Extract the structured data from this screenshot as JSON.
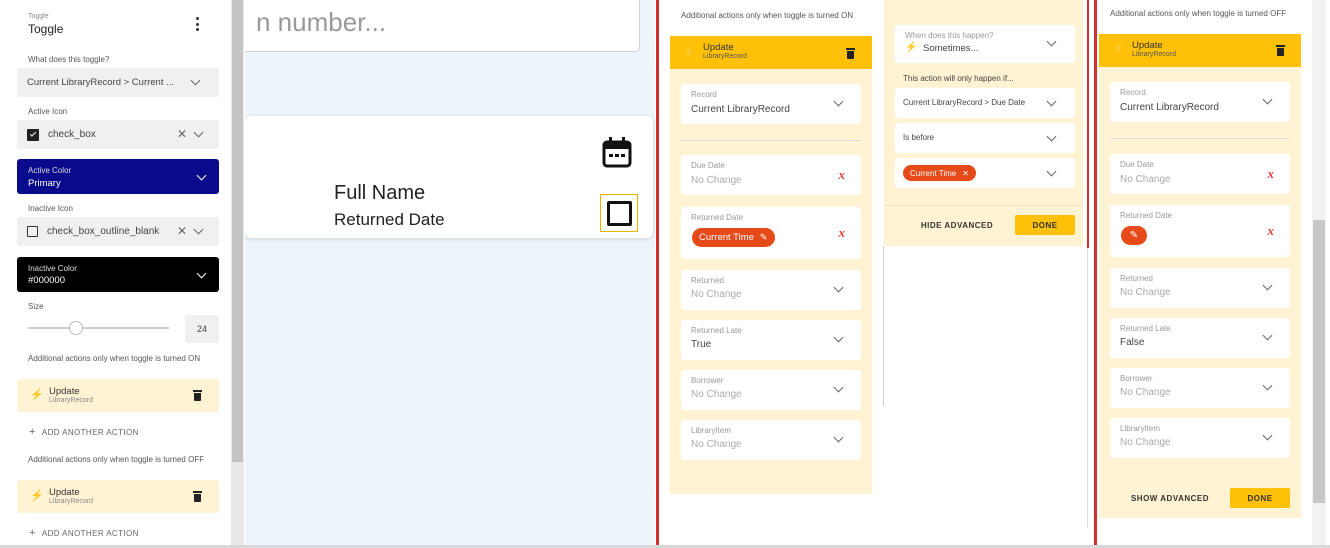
{
  "left_panel": {
    "small_title": "Toggle",
    "title": "Toggle",
    "what_label": "What does this toggle?",
    "what_value": "Current LibraryRecord > Current ...",
    "active_icon_label": "Active Icon",
    "active_icon_value": "check_box",
    "active_color_label": "Active Color",
    "active_color_value": "Primary",
    "active_color_hex": "#0a0a8c",
    "inactive_icon_label": "Inactive Icon",
    "inactive_icon_value": "check_box_outline_blank",
    "inactive_color_label": "Inactive Color",
    "inactive_color_value": "#000000",
    "size_label": "Size",
    "size_value": "24",
    "on_actions_label": "Additional actions only when toggle is turned ON",
    "on_action_title": "Update",
    "on_action_sub": "LibraryRecord",
    "add_action_1": "ADD ANOTHER ACTION",
    "off_actions_label": "Additional actions only when toggle is turned OFF",
    "off_action_title": "Update",
    "off_action_sub": "LibraryRecord",
    "add_action_2": "ADD ANOTHER ACTION"
  },
  "canvas": {
    "search_placeholder": "n number...",
    "full_name": "Full Name",
    "returned_date": "Returned Date"
  },
  "on_panel": {
    "header": "Additional actions only when toggle is turned ON",
    "action_title": "Update",
    "action_sub": "LibraryRecord",
    "record_label": "Record",
    "record_value": "Current LibraryRecord",
    "due_date_label": "Due Date",
    "due_date_value": "No Change",
    "returned_date_label": "Returned Date",
    "returned_date_chip": "Current Time",
    "returned_label": "Returned",
    "returned_value": "No Change",
    "returned_late_label": "Returned Late",
    "returned_late_value": "True",
    "borrower_label": "Borrower",
    "borrower_value": "No Change",
    "library_item_label": "LibraryItem",
    "library_item_value": "No Change"
  },
  "advanced": {
    "when_label": "When does this happen?",
    "when_value": "Sometimes...",
    "condition_text": "This action will only happen if...",
    "cond_field": "Current LibraryRecord > Due Date",
    "cond_op": "Is before",
    "cond_chip": "Current Time",
    "hide_btn": "HIDE ADVANCED",
    "done_btn": "DONE"
  },
  "off_panel": {
    "header": "Additional actions only when toggle is turned OFF",
    "action_title": "Update",
    "action_sub": "LibraryRecord",
    "record_label": "Record",
    "record_value": "Current LibraryRecord",
    "due_date_label": "Due Date",
    "due_date_value": "No Change",
    "returned_date_label": "Returned Date",
    "returned_label": "Returned",
    "returned_value": "No Change",
    "returned_late_label": "Returned Late",
    "returned_late_value": "False",
    "borrower_label": "Borrower",
    "borrower_value": "No Change",
    "library_item_label": "LibraryItem",
    "library_item_value": "No Change",
    "show_btn": "SHOW ADVANCED",
    "done_btn": "DONE"
  },
  "colors": {
    "accent_yellow": "#ffc107",
    "light_yellow": "#fff3d4",
    "chip_orange": "#e64a19",
    "red_bar": "#d32f2f",
    "canvas_bg": "#edf4fc"
  },
  "x_icon_text": "x"
}
